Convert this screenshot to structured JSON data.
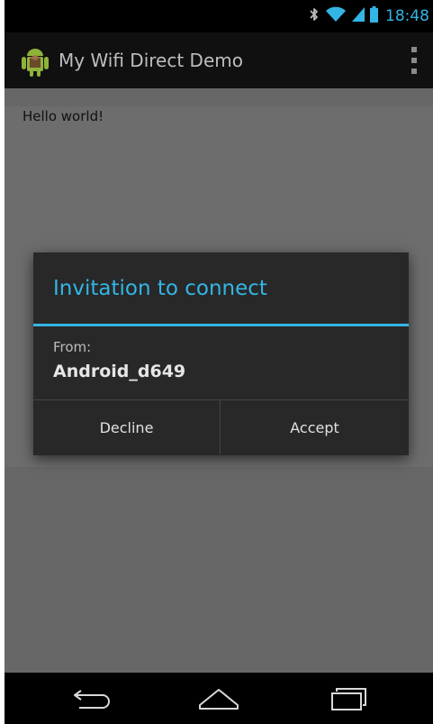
{
  "status_bar": {
    "time": "18:48",
    "icons": [
      "bluetooth-icon",
      "wifi-icon",
      "cell-signal-icon",
      "battery-icon"
    ],
    "accent_color": "#33b5e5"
  },
  "action_bar": {
    "title": "My Wifi Direct Demo",
    "app_icon": "android-icon",
    "menu_icon": "overflow-menu-icon"
  },
  "content": {
    "text": "Hello world!"
  },
  "dialog": {
    "title": "Invitation to connect",
    "from_label": "From:",
    "from_value": "Android_d649",
    "decline_label": "Decline",
    "accept_label": "Accept",
    "accent_color": "#33b5e5"
  },
  "nav_bar": {
    "icons": [
      "back-icon",
      "home-icon",
      "recent-apps-icon"
    ]
  }
}
